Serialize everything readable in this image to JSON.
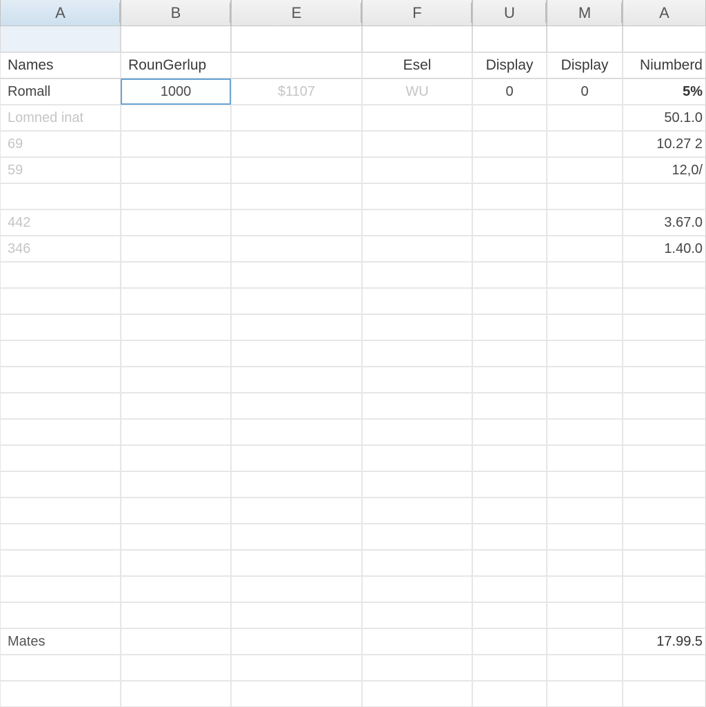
{
  "columns": [
    "A",
    "B",
    "E",
    "F",
    "U",
    "M",
    "A"
  ],
  "headers": {
    "c0": "Names",
    "c1": "RounGerlup",
    "c2": "",
    "c3": "Esel",
    "c4": "Display",
    "c5": "Display",
    "c6": "Niumberd"
  },
  "row_data": {
    "r3": {
      "c0": "Romall",
      "c1": "1000",
      "c2": "$1107",
      "c3": "WU",
      "c4": "0",
      "c5": "0",
      "c6": "5%"
    },
    "r4": {
      "c0": "Lomned inat",
      "c6": "50.1.0"
    },
    "r5": {
      "c0": "69",
      "c6": "10.27 2"
    },
    "r6": {
      "c0": "59",
      "c6": "12,0/"
    },
    "r8": {
      "c0": "442",
      "c6": "3.67.0"
    },
    "r9": {
      "c0": "346",
      "c6": "1.40.0"
    },
    "r24": {
      "c0": "Mates",
      "c6": "17.99.5"
    }
  },
  "selected_cell": {
    "row": 3,
    "col": 1
  }
}
